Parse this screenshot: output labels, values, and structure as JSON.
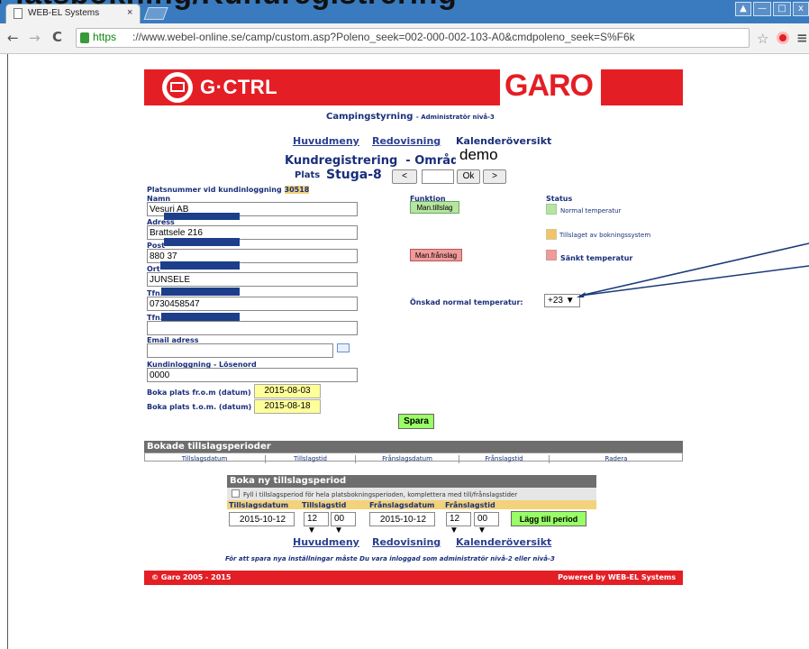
{
  "overlay_title": "Platsbokning/Kundregistrering",
  "browser": {
    "tab_title": "WEB-EL Systems",
    "tab_close": "×",
    "url_https": "https",
    "url_rest": "://www.webel-online.se/camp/custom.asp?Poleno_seek=002-000-002-103-A0&cmdpoleno_seek=S%F6k",
    "win_buttons": [
      "▲",
      "—",
      "□",
      "x"
    ]
  },
  "header": {
    "left_logo_text": "G·CTRL",
    "right_logo_text": "GARO"
  },
  "title": {
    "main": "Campingstyrning",
    "sub": "- Administratör nivå-3"
  },
  "nav": {
    "huvudmeny": "Huvudmeny",
    "redovisning": "Redovisning",
    "kalender": "Kalenderöversikt"
  },
  "area": {
    "label": "Kundregistrering  - Område",
    "value": "demo"
  },
  "plats": {
    "label": "Plats",
    "value": "Stuga-8",
    "prev": "<",
    "ok": "Ok",
    "next": ">"
  },
  "form": {
    "platsnummer_label": "Platsnummer vid kundinloggning",
    "platsnummer_value": "30518",
    "namn_label": "Namn",
    "namn_value": "Vesuri AB",
    "adress_label": "Adress",
    "adress_value": "Brattsele 216",
    "post_label": "Post",
    "post_value": "880 37",
    "ort_label": "Ort",
    "ort_value": "JUNSELE",
    "tfn1_label": "Tfn.",
    "tfn1_value": "0730458547",
    "tfn2_label": "Tfn.",
    "tfn2_value": "",
    "email_label": "Email adress",
    "email_value": "",
    "login_label": "Kundinloggning - Lösenord",
    "login_value": "0000",
    "from_label": "Boka plats fr.o.m (datum)",
    "from_value": "2015-08-03",
    "tom_label": "Boka plats t.o.m. (datum)",
    "tom_value": "2015-08-18"
  },
  "funktion": {
    "label": "Funktion",
    "on": "Man.tillslag",
    "off": "Man.frånslag"
  },
  "status": {
    "label": "Status",
    "normal": "Normal temperatur",
    "booking": "Tillslaget av bokningssystem",
    "lowered": "Sänkt temperatur",
    "colors": {
      "normal": "#b7e4a0",
      "booking": "#f2c46a",
      "lowered": "#f09a9a"
    }
  },
  "temp": {
    "label": "Önskad normal temperatur:",
    "value": "+23 ▼"
  },
  "save": "Spara",
  "booked": {
    "title": "Bokade tillslagsperioder",
    "columns": [
      "Tillslagsdatum",
      "Tillslagstid",
      "Frånslagsdatum",
      "Frånslagstid",
      "Radera"
    ]
  },
  "newbook": {
    "title": "Boka ny tillslagsperiod",
    "checkbox_label": "Fyll i tillslagsperiod för hela platsbokningsperioden, komplettera med till/frånslagstider",
    "h_tillslagsdatum": "Tillslagsdatum",
    "h_tillslagstid": "Tillslagstid",
    "h_franslagsdatum": "Frånslagsdatum",
    "h_franslagstid": "Frånslagstid",
    "on_date": "2015-10-12",
    "on_hour": "12 ▼",
    "on_min": "00 ▼",
    "off_date": "2015-10-12",
    "off_hour": "12 ▼",
    "off_min": "00 ▼",
    "add_button": "Lägg till period"
  },
  "bottom_nav": {
    "huvudmeny": "Huvudmeny",
    "redovisning": "Redovisning",
    "kalender": "Kalenderöversikt"
  },
  "note": "För att spara nya inställningar måste Du vara inloggad som administratör nivå-2 eller nivå-3",
  "footer": {
    "left": "© Garo  2005 - 2015",
    "right": "Powered by WEB-EL Systems"
  }
}
